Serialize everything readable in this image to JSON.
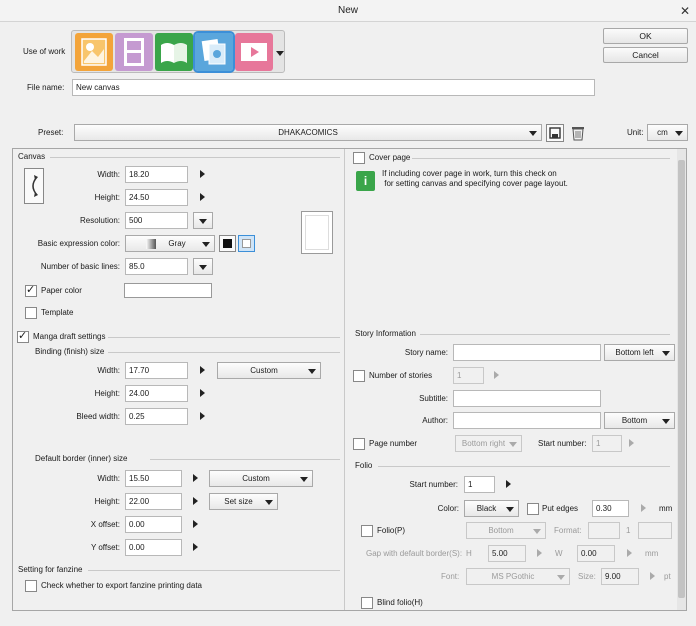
{
  "window": {
    "title": "New",
    "close_glyph": "✕"
  },
  "top": {
    "use_of_work_label": "Use of work",
    "file_name_label": "File name:",
    "file_name_value": "New canvas",
    "ok": "OK",
    "cancel": "Cancel",
    "preset_label": "Preset:",
    "preset_value": "DHAKACOMICS",
    "unit_label": "Unit:",
    "unit_value": "cm"
  },
  "work_icons": [
    "illustration-icon",
    "webtoon-icon",
    "comic-icon",
    "all-comic-settings-icon",
    "animation-icon"
  ],
  "canvas": {
    "section": "Canvas",
    "width_label": "Width:",
    "width": "18.20",
    "height_label": "Height:",
    "height": "24.50",
    "resolution_label": "Resolution:",
    "resolution": "500",
    "expr_label": "Basic expression color:",
    "expr_value": "Gray",
    "lines_label": "Number of basic lines:",
    "lines": "85.0",
    "paper_color": "Paper color",
    "template": "Template"
  },
  "manga": {
    "settings": "Manga draft settings",
    "binding": "Binding (finish) size",
    "width_label": "Width:",
    "width": "17.70",
    "height_label": "Height:",
    "height": "24.00",
    "bleed_label": "Bleed width:",
    "bleed": "0.25",
    "custom": "Custom",
    "border": "Default border (inner) size",
    "b_width": "15.50",
    "b_height": "22.00",
    "set_size": "Set size",
    "xoff_label": "X offset:",
    "xoff": "0.00",
    "yoff_label": "Y offset:",
    "yoff": "0.00",
    "fanzine": "Setting for fanzine",
    "fanzine_check": "Check whether to export fanzine printing data"
  },
  "cover": {
    "label": "Cover page",
    "info": "If including cover page in work, turn this check on\n for setting canvas and specifying cover page layout."
  },
  "story": {
    "section": "Story Information",
    "name_label": "Story name:",
    "name_pos": "Bottom left",
    "num_label": "Number of stories",
    "num": "1",
    "subtitle_label": "Subtitle:",
    "author_label": "Author:",
    "author_pos": "Bottom",
    "page_number": "Page number",
    "page_pos": "Bottom right",
    "start_label": "Start number:",
    "start": "1"
  },
  "folio": {
    "section": "Folio",
    "start_label": "Start number:",
    "start": "1",
    "color_label": "Color:",
    "color": "Black",
    "put_edges": "Put edges",
    "edges": "0.30",
    "mm": "mm",
    "folio_p": "Folio(P)",
    "pos": "Bottom",
    "format_label": "Format:",
    "format_num": "1",
    "gap_label": "Gap with default border(S):",
    "h_label": "H",
    "h": "5.00",
    "w_label": "W",
    "w": "0.00",
    "mm2": "mm",
    "font_label": "Font:",
    "font": "MS PGothic",
    "size_label": "Size:",
    "size": "9.00",
    "pt": "pt",
    "blind": "Blind folio(H)"
  },
  "colors": {
    "accent": "#3c8fd8",
    "orange": "#f3a43a",
    "purple": "#c59ad1",
    "green": "#3aa54a",
    "blue": "#5aa6dc",
    "pink": "#e7779a"
  }
}
